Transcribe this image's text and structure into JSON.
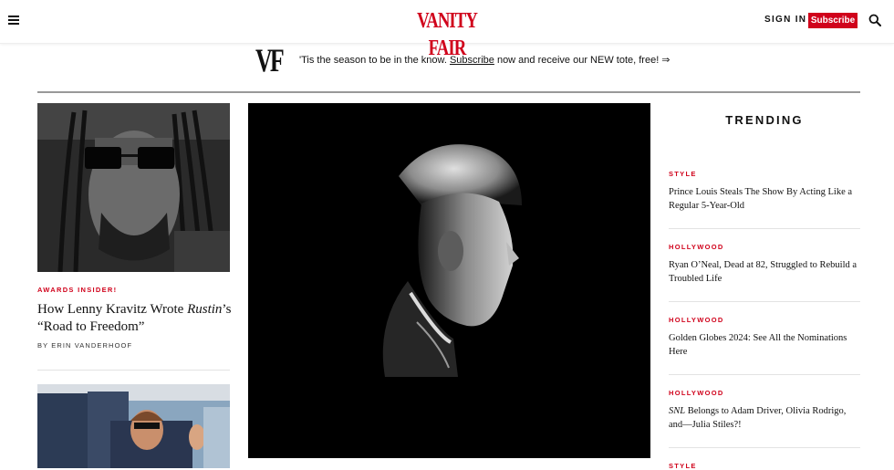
{
  "header": {
    "logo": "VANITY FAIR",
    "signin": "SIGN IN",
    "subscribe": "Subscribe"
  },
  "promo": {
    "mark": "VF",
    "text_before": "'Tis the season to be in the know. ",
    "link": "Subscribe",
    "text_after": " now and receive our NEW tote, free! ⇒"
  },
  "left": {
    "story1": {
      "kicker": "AWARDS INSIDER!",
      "headline_pre": "How Lenny Kravitz Wrote ",
      "headline_italic": "Rustin",
      "headline_post": "’s “Road to Freedom”",
      "byline": "BY ERIN VANDERHOOF"
    }
  },
  "trending": {
    "title": "TRENDING",
    "items": [
      {
        "kicker": "STYLE",
        "headline": "Prince Louis Steals The Show By Acting Like a Regular 5-Year-Old"
      },
      {
        "kicker": "HOLLYWOOD",
        "headline": "Ryan O’Neal, Dead at 82, Struggled to Rebuild a Troubled Life"
      },
      {
        "kicker": "HOLLYWOOD",
        "headline": "Golden Globes 2024: See All the Nominations Here"
      },
      {
        "kicker": "HOLLYWOOD",
        "headline_italic": "SNL",
        "headline": " Belongs to Adam Driver, Olivia Rodrigo, and—Julia Stiles?!"
      },
      {
        "kicker": "STYLE"
      }
    ]
  },
  "colors": {
    "brand_red": "#d0021b",
    "hero_bg": "#000000"
  },
  "icons": [
    "hamburger-menu-icon",
    "search-icon"
  ]
}
